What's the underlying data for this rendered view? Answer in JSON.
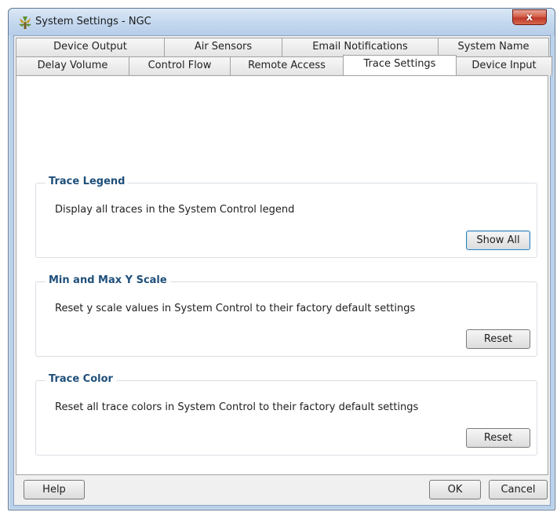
{
  "window": {
    "title": "System Settings - NGC",
    "close_glyph": "x"
  },
  "tabs": {
    "top": [
      "Device Output",
      "Air Sensors",
      "Email Notifications",
      "System Name"
    ],
    "bottom": [
      "Delay Volume",
      "Control Flow",
      "Remote Access",
      "Trace Settings",
      "Device Input"
    ],
    "active": "Trace Settings"
  },
  "groups": [
    {
      "title": "Trace Legend",
      "text": "Display all traces in the System Control legend",
      "button": "Show All"
    },
    {
      "title": "Min and Max Y Scale",
      "text": "Reset y scale values in System Control to their factory default settings",
      "button": "Reset"
    },
    {
      "title": "Trace Color",
      "text": "Reset all trace colors in System Control to their factory default settings",
      "button": "Reset"
    }
  ],
  "footer": {
    "help": "Help",
    "ok": "OK",
    "cancel": "Cancel"
  },
  "colors": {
    "group_title": "#1f4f7a",
    "close_button": "#c0392b",
    "focus_border": "#3c7fb1"
  }
}
